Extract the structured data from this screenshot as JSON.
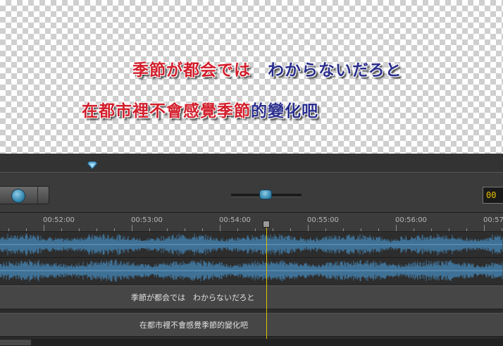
{
  "preview": {
    "line1": {
      "sung": "季節が都会では",
      "unsung": "　わからないだろと"
    },
    "line2": {
      "sung": "在都市裡不會感覺季節",
      "unsung": "的變化吧"
    }
  },
  "toolbar": {
    "time_value": "00",
    "zoom_level": 0.5
  },
  "ruler": {
    "labels": [
      "00:52:00",
      "00:53:00",
      "00:54:00",
      "00:55:00",
      "00:56:00",
      "00:57"
    ]
  },
  "tracks": [
    {
      "text": "季節が都会では　わからないだろと"
    },
    {
      "text": "在都市裡不會感覺季節的變化吧"
    }
  ],
  "colors": {
    "sung": "#d21e2b",
    "unsung": "#2a2e8c",
    "playhead": "#e0c000",
    "waveform": "#3f7196"
  }
}
